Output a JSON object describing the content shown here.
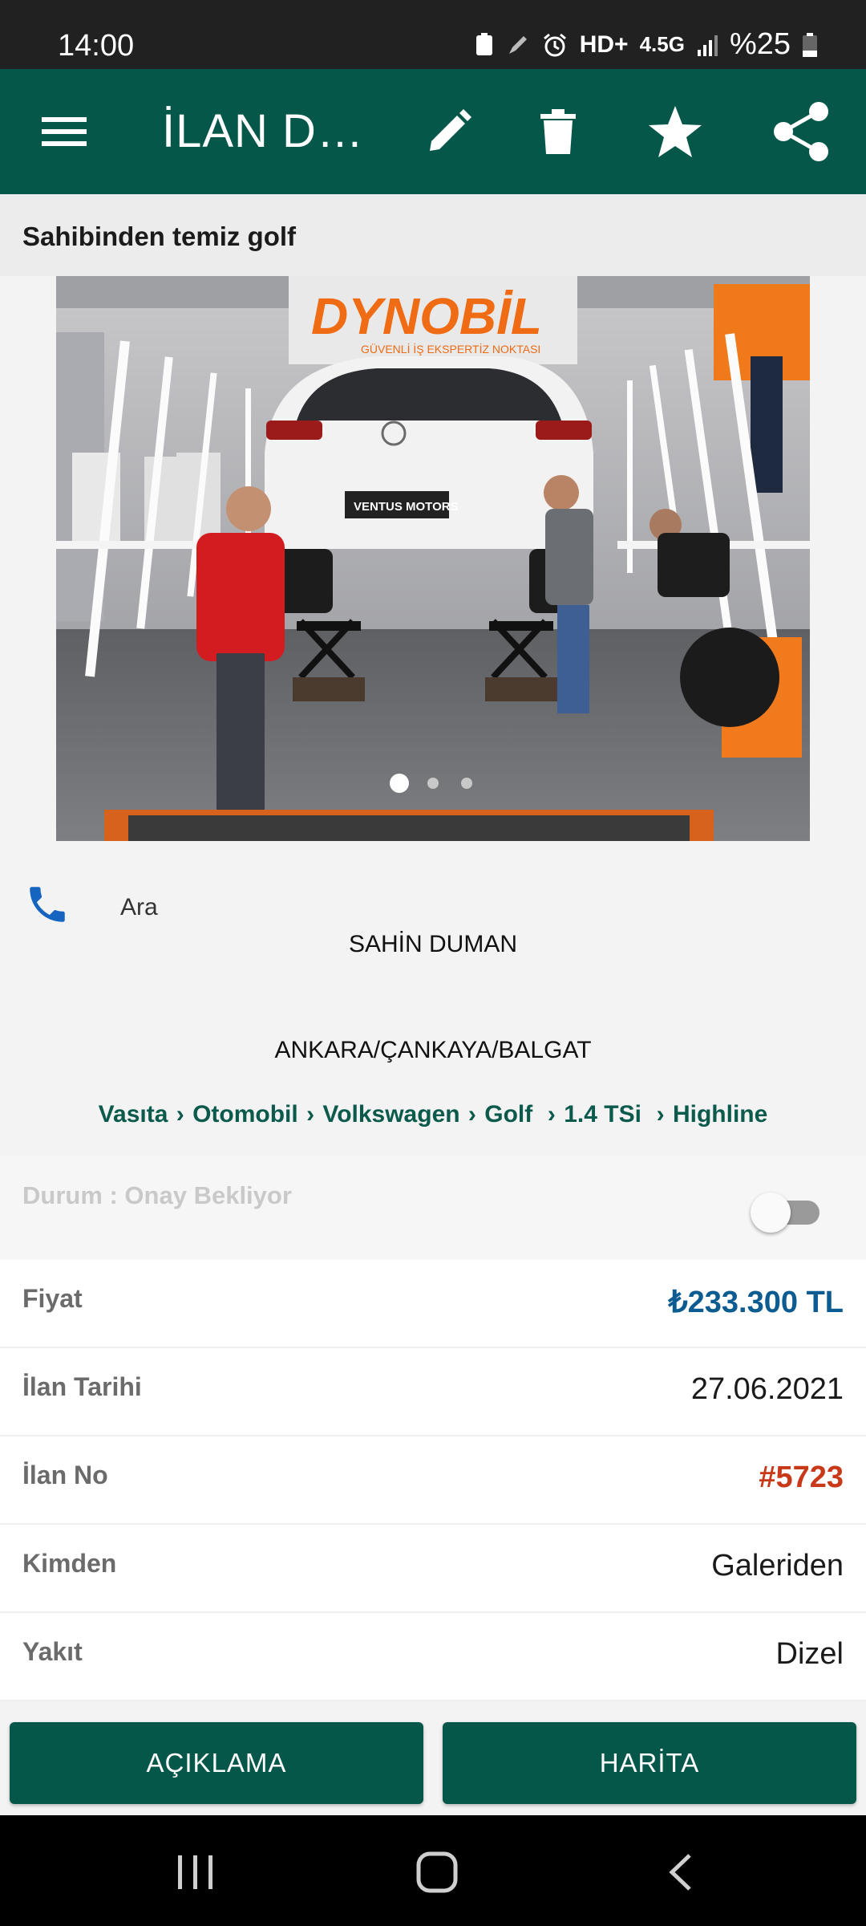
{
  "status_bar": {
    "time": "14:00",
    "network": "HD+",
    "network_sub": "4.5G",
    "battery_text": "%25"
  },
  "app_bar": {
    "title": "İLAN DETAYI",
    "icons": [
      "menu-icon",
      "edit-icon",
      "delete-icon",
      "star-icon",
      "share-icon"
    ]
  },
  "listing": {
    "subtitle": "Sahibinden temiz golf",
    "photo": {
      "sign_brand": "DYNOBİL",
      "sign_tagline": "GÜVENLİ İŞ EKSPERTİZ NOKTASI",
      "plate_text": "VENTUS MOTORS",
      "page_count": 3,
      "current_page": 1
    },
    "contact": {
      "call_label": "Ara",
      "seller_name": "SAHİN DUMAN",
      "location": "ANKARA/ÇANKAYA/BALGAT"
    },
    "breadcrumb": [
      "Vasıta",
      "Otomobil",
      "Volkswagen",
      "Golf",
      "1.4 TSi",
      "Highline"
    ],
    "state": {
      "label": "Durum : Onay Bekliyor",
      "toggle_on": false
    },
    "details": [
      {
        "key": "Fiyat",
        "value": "₺233.300 TL",
        "color": "#0d5c91"
      },
      {
        "key": "İlan Tarihi",
        "value": "27.06.2021",
        "color": "#1a1a1a"
      },
      {
        "key": "İlan No",
        "value": "#5723",
        "color": "#c8391a"
      },
      {
        "key": "Kimden",
        "value": "Galeriden",
        "color": "#1a1a1a"
      },
      {
        "key": "Yakıt",
        "value": "Dizel",
        "color": "#1a1a1a"
      }
    ]
  },
  "buttons": {
    "description": "AÇIKLAMA",
    "map": "HARİTA"
  },
  "colors": {
    "primary": "#05574a",
    "phone_icon": "#1565c0"
  }
}
